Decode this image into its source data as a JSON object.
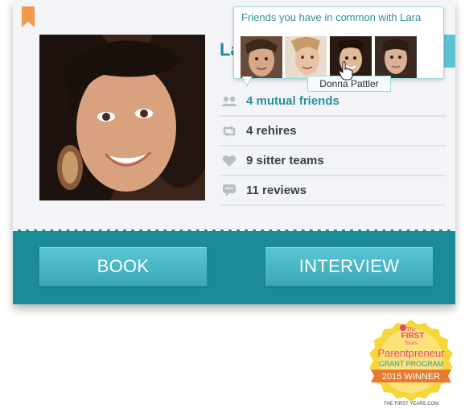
{
  "profile": {
    "name_partial": "La",
    "stats": [
      {
        "icon": "people-icon",
        "label": "4 mutual friends",
        "link": true
      },
      {
        "icon": "retweet-icon",
        "label": "4 rehires",
        "link": false
      },
      {
        "icon": "heart-icon",
        "label": "9 sitter teams",
        "link": false
      },
      {
        "icon": "speech-bubble-icon",
        "label": "11 reviews",
        "link": false
      }
    ]
  },
  "actions": {
    "book": "BOOK",
    "interview": "INTERVIEW"
  },
  "popover": {
    "title": "Friends you have in common with Lara",
    "hover_name": "Donna Pattler"
  },
  "badge": {
    "line1": "The",
    "line2": "FIRST",
    "line3": "Years",
    "line4": "Parentpreneur",
    "line5": "GRANT PROGRAM",
    "line6": "2015 WINNER",
    "footer": "THE FIRST YEARS.COM"
  },
  "colors": {
    "accent": "#1c8b98",
    "button": "#4bb8c8",
    "bookmark": "#f29a4a"
  }
}
